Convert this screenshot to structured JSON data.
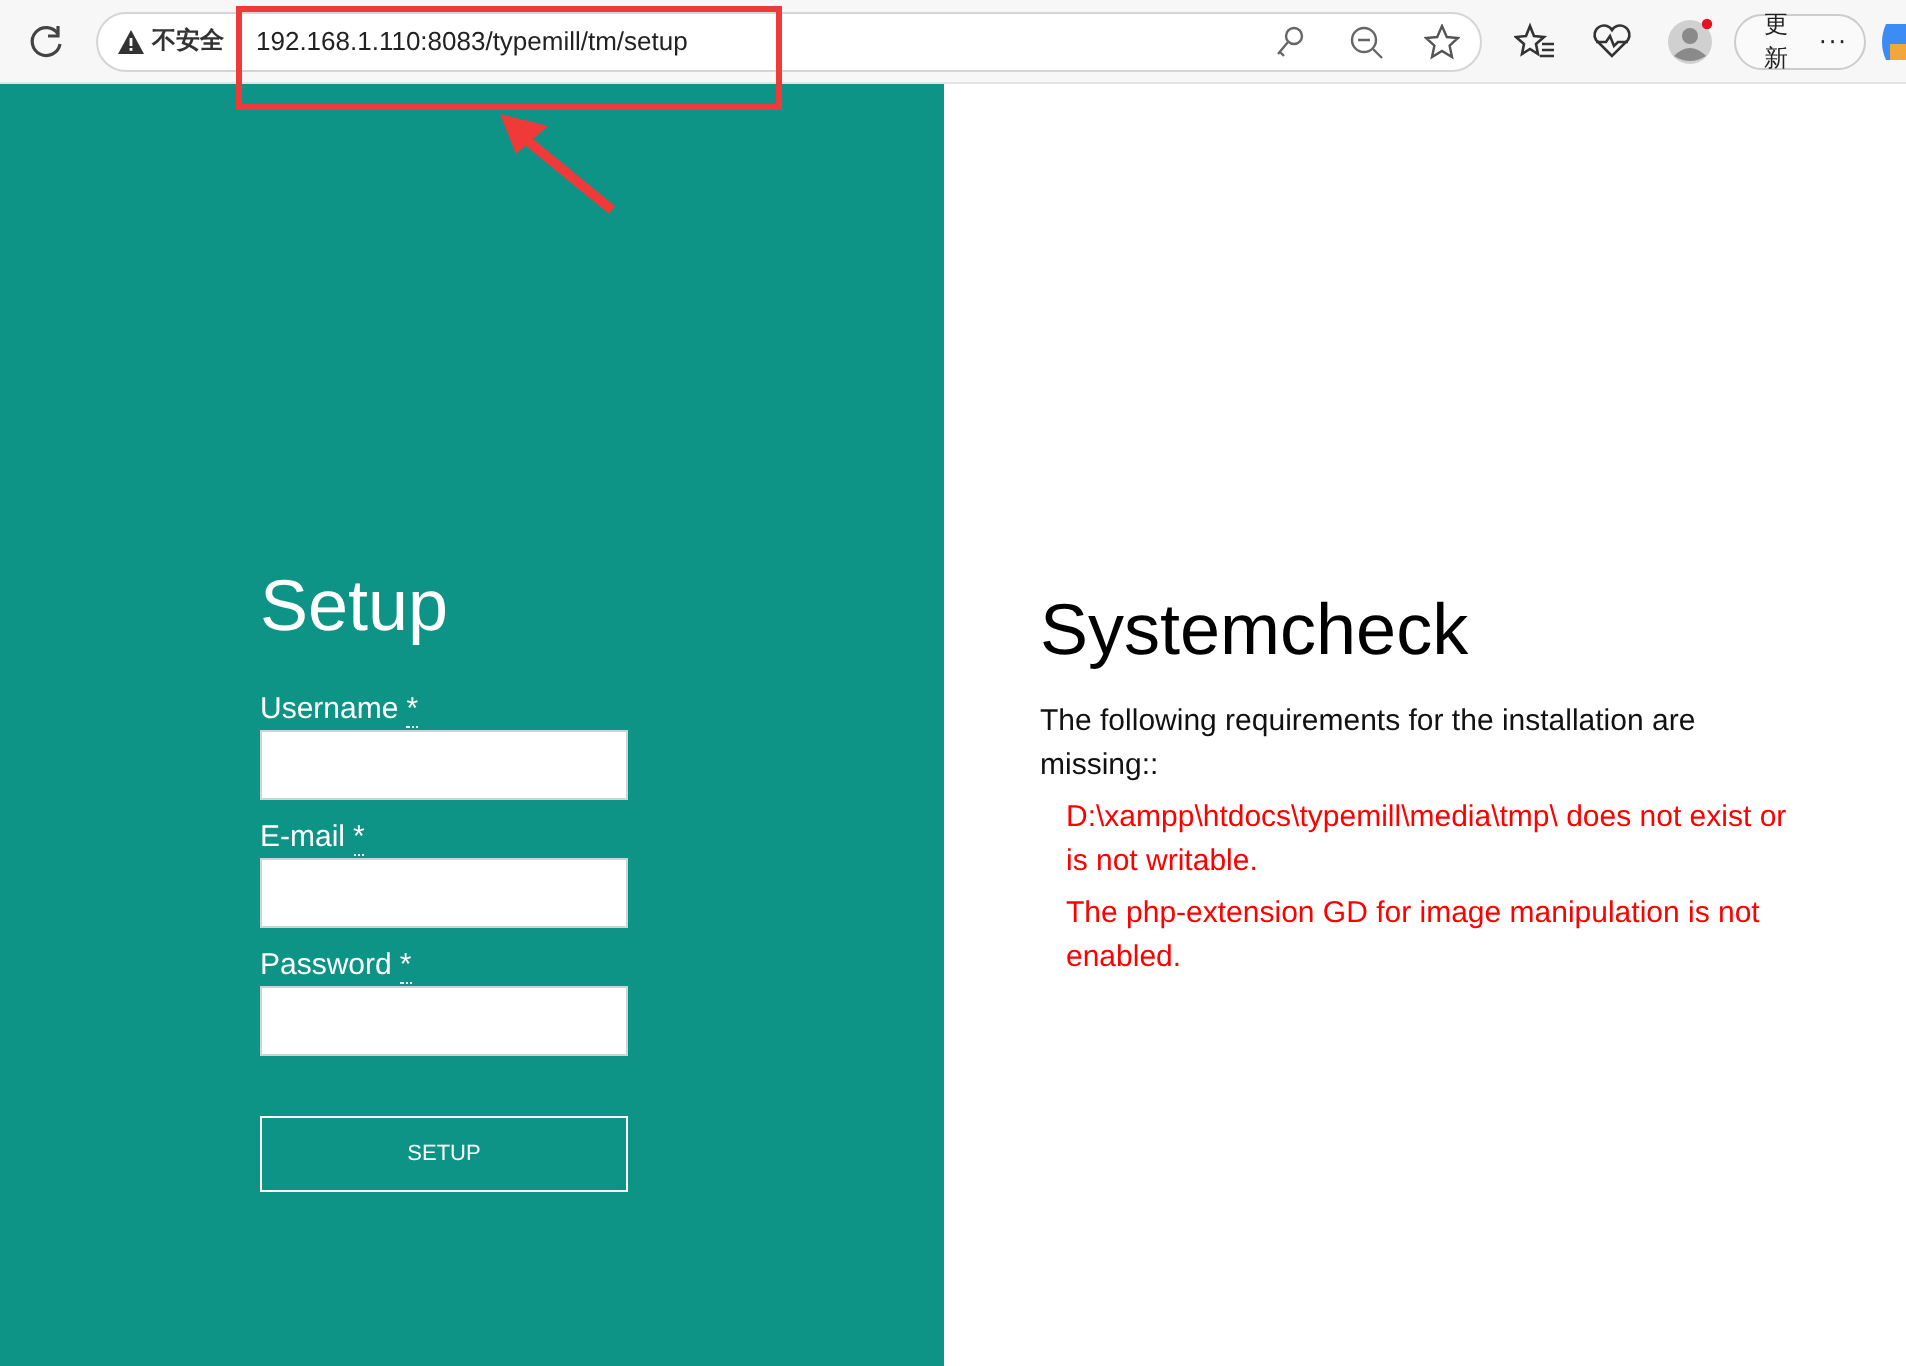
{
  "browser": {
    "security_label": "不安全",
    "url": "192.168.1.110:8083/typemill/tm/setup",
    "update_button": "更新",
    "more_button": "···"
  },
  "setup": {
    "title": "Setup",
    "fields": [
      {
        "label": "Username",
        "required_mark": "*"
      },
      {
        "label": "E-mail",
        "required_mark": "*"
      },
      {
        "label": "Password",
        "required_mark": "*"
      }
    ],
    "button": "SETUP"
  },
  "systemcheck": {
    "title": "Systemcheck",
    "intro": "The following requirements for the installation are missing::",
    "errors": [
      "D:\\xampp\\htdocs\\typemill\\media\\tmp\\ does not exist or is not writable.",
      "The php-extension GD for image manipulation is not enabled."
    ]
  }
}
